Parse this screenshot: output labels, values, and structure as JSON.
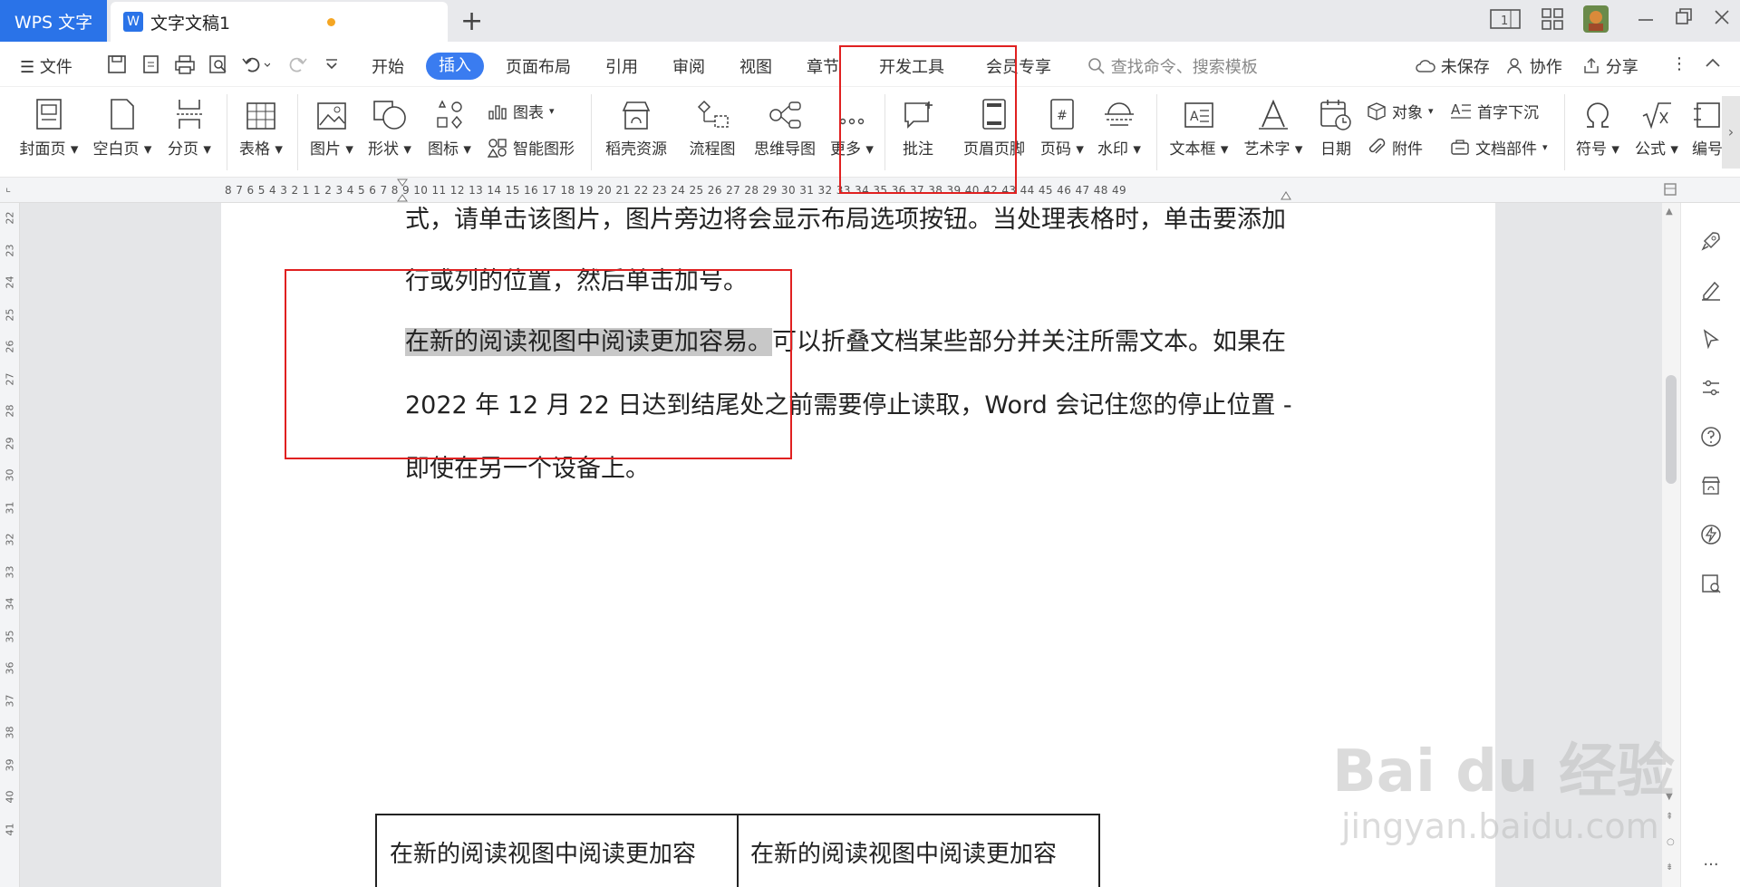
{
  "titlebar": {
    "app_tab": "WPS 文字",
    "doc_tab": "文字文稿1",
    "add_tab": "+"
  },
  "menu": {
    "file": "文件",
    "tabs": [
      "开始",
      "插入",
      "页面布局",
      "引用",
      "审阅",
      "视图",
      "章节",
      "开发工具",
      "会员专享"
    ],
    "active_tab": "插入",
    "search_placeholder": "查找命令、搜索模板",
    "unsaved": "未保存",
    "collab": "协作",
    "share": "分享"
  },
  "ribbon": {
    "cover": "封面页",
    "blank": "空白页",
    "pagebreak": "分页",
    "table": "表格",
    "picture": "图片",
    "shape": "形状",
    "icon": "图标",
    "chart": "图表",
    "smartart": "智能图形",
    "docer": "稻壳资源",
    "flowchart": "流程图",
    "mindmap": "思维导图",
    "more": "更多",
    "comment": "批注",
    "header_footer": "页眉页脚",
    "pagenum": "页码",
    "watermark": "水印",
    "textbox": "文本框",
    "wordart": "艺术字",
    "date": "日期",
    "object": "对象",
    "attachment": "附件",
    "dropcap": "首字下沉",
    "docpart": "文档部件",
    "symbol": "符号",
    "formula": "公式",
    "edit": "编号"
  },
  "ruler": {
    "text": "8 7 6 5 4 3 2 1  1 2 3 4 5 6 7 8 9 10 11 12 13 14 15 16 17 18 19 20 21 22 23 24 25 26 27 28 29 30 31 32 33 34 35 36 37 38 39 40  42 43 44 45 46 47 48 49"
  },
  "vruler": [
    "22",
    "23",
    "24",
    "25",
    "26",
    "27",
    "28",
    "29",
    "30",
    "31",
    "32",
    "33",
    "34",
    "35",
    "36",
    "37",
    "38",
    "39",
    "40",
    "41"
  ],
  "document": {
    "line0": "式，请单击该图片，图片旁边将会显示布局选项按钮。当处理表格时，单击要添加",
    "line1": "行或列的位置，然后单击加号。",
    "line2_highlight": "在新的阅读视图中阅读更加容易。",
    "line2_rest": "可以折叠文档某些部分并关注所需文本。如果在",
    "line3": "2022 年 12 月 22 日达到结尾处之前需要停止读取，Word  会记住您的停止位置 -",
    "line4": "即使在另一个设备上。",
    "table_cell1": "在新的阅读视图中阅读更加容",
    "table_cell2": "在新的阅读视图中阅读更加容"
  },
  "watermark": {
    "brand": "Bai du 经验",
    "url": "jingyan.baidu.com"
  },
  "colors": {
    "accent": "#3a7cf0",
    "wps_tab": "#2a73e8",
    "highlight": "#c8c8c8",
    "annotation": "#e02020"
  }
}
